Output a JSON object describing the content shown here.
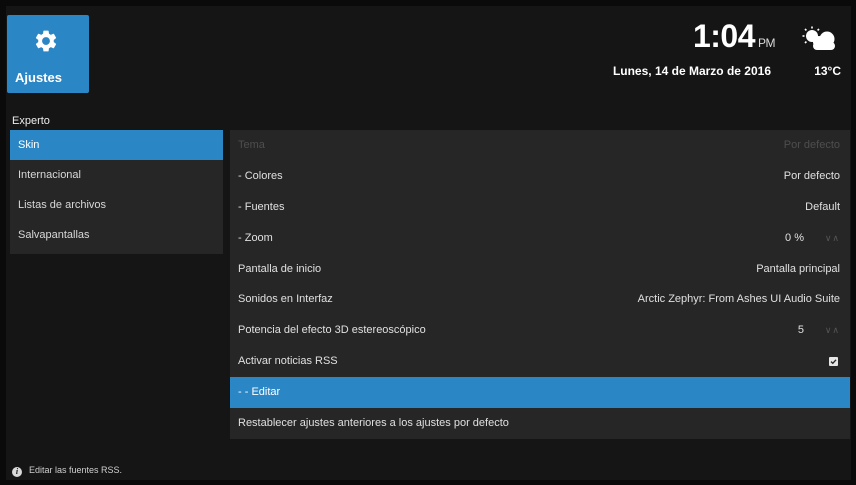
{
  "header": {
    "section_title": "Ajustes",
    "section_icon": "gear-icon",
    "time": "1:04",
    "ampm": "PM",
    "date": "Lunes, 14 de Marzo de 2016",
    "temperature": "13°C",
    "weather_icon": "partly-cloudy-icon"
  },
  "settings_level": "Experto",
  "categories": [
    {
      "label": "Skin"
    },
    {
      "label": "Internacional"
    },
    {
      "label": "Listas de archivos"
    },
    {
      "label": "Salvapantallas"
    }
  ],
  "options": [
    {
      "label": "Tema",
      "value": "Por defecto"
    },
    {
      "label": "- Colores",
      "value": "Por defecto"
    },
    {
      "label": "- Fuentes",
      "value": "Default"
    },
    {
      "label": "- Zoom",
      "value": "0 %"
    },
    {
      "label": "Pantalla de inicio",
      "value": "Pantalla principal"
    },
    {
      "label": "Sonidos en Interfaz",
      "value": "Arctic Zephyr: From Ashes UI Audio Suite"
    },
    {
      "label": "Potencia del efecto 3D estereoscópico",
      "value": "5"
    },
    {
      "label": "Activar noticias RSS",
      "checked": true
    },
    {
      "label": "- - Editar"
    },
    {
      "label": "Restablecer ajustes anteriores a los ajustes por defecto"
    }
  ],
  "footer": {
    "info_text": "Editar las fuentes RSS."
  },
  "colors": {
    "accent": "#2b86c5",
    "background": "#151515",
    "panel": "#262626"
  }
}
